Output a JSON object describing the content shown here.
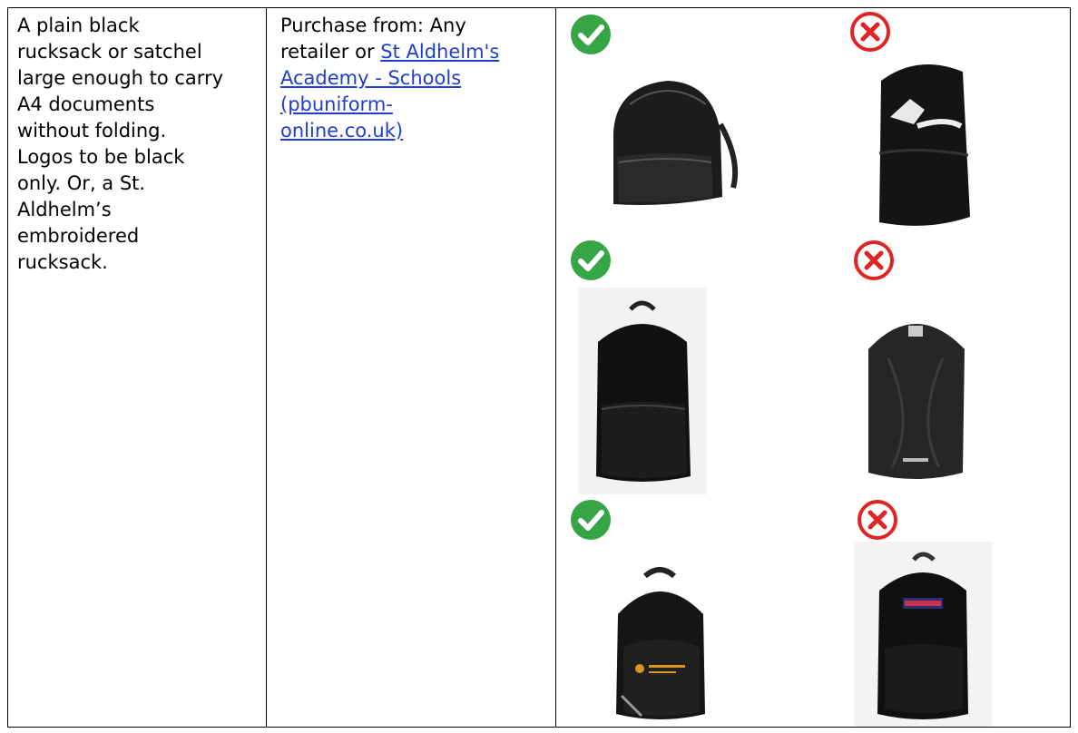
{
  "requirement": {
    "lines": [
      "A plain black",
      "rucksack or satchel",
      "large enough to carry",
      "A4 documents",
      "without folding.",
      "Logos to be black",
      "only. Or, a St.",
      "Aldhelm’s",
      "embroidered",
      "rucksack."
    ]
  },
  "purchase": {
    "prefix_line1": "Purchase from: Any",
    "prefix_line2": "retailer or ",
    "link_lines": [
      "St Aldhelm's",
      "Academy - Schools",
      "(pbuniform-",
      "online.co.uk)"
    ]
  },
  "examples": {
    "approved_icon": "check-circle-icon",
    "rejected_icon": "x-circle-icon",
    "approved_color": "#36a546",
    "rejected_color": "#e02424"
  }
}
